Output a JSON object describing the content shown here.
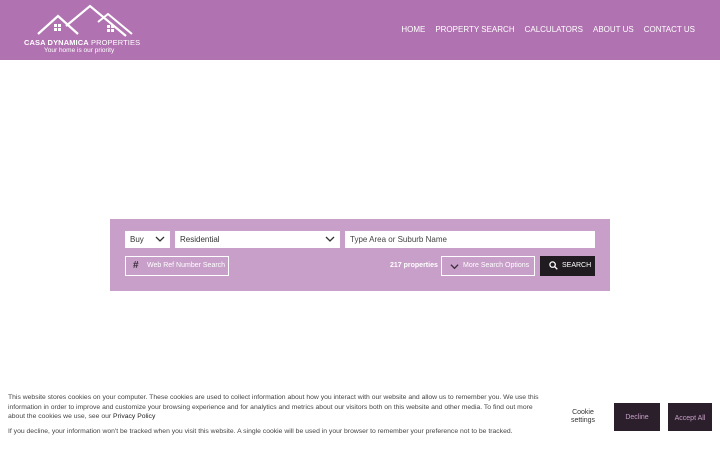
{
  "brand": {
    "name_bold": "CASA DYNAMICA",
    "name_light": "PROPERTIES",
    "tagline": "Your home is our priority",
    "color": "#b072b0"
  },
  "nav": {
    "items": [
      {
        "label": "HOME"
      },
      {
        "label": "PROPERTY SEARCH"
      },
      {
        "label": "CALCULATORS"
      },
      {
        "label": "ABOUT US"
      },
      {
        "label": "CONTACT US"
      }
    ]
  },
  "search": {
    "listing_type": "Buy",
    "property_type": "Residential",
    "area_placeholder": "Type Area or Suburb Name",
    "web_ref_label": "Web Ref Number Search",
    "property_count": "217 properties",
    "more_options_label": "More Search Options",
    "search_label": "SEARCH",
    "panel_color": "#c79fc9"
  },
  "cookie": {
    "text_1": "This website stores cookies on your computer. These cookies are used to collect information about how you interact with our website and allow us to remember you. We use this information in order to improve and customize your browsing experience and for analytics and metrics about our visitors both on this website and other media. To find out more about the cookies we use, see our",
    "policy_link": "Privacy Policy",
    "text_2": "If you decline, your information won't be tracked when you visit this website. A single cookie will be used in your browser to remember your preference not to be tracked.",
    "settings_label": "Cookie settings",
    "decline_label": "Decline",
    "accept_label": "Accept All"
  },
  "icons": {
    "logo": "house-roofs-logo",
    "dropdown": "chevron-down-icon",
    "hash": "hash-icon",
    "search": "search-icon"
  }
}
